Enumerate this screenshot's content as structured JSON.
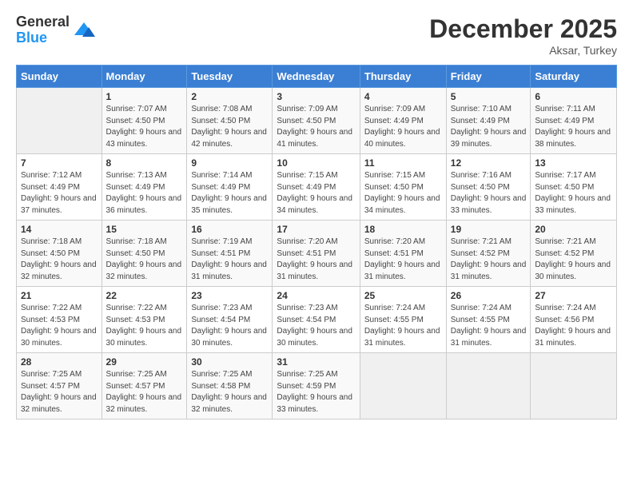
{
  "logo": {
    "general": "General",
    "blue": "Blue"
  },
  "title": "December 2025",
  "location": "Aksar, Turkey",
  "days_header": [
    "Sunday",
    "Monday",
    "Tuesday",
    "Wednesday",
    "Thursday",
    "Friday",
    "Saturday"
  ],
  "weeks": [
    [
      {
        "day": "",
        "sunrise": "",
        "sunset": "",
        "daylight": ""
      },
      {
        "day": "1",
        "sunrise": "Sunrise: 7:07 AM",
        "sunset": "Sunset: 4:50 PM",
        "daylight": "Daylight: 9 hours and 43 minutes."
      },
      {
        "day": "2",
        "sunrise": "Sunrise: 7:08 AM",
        "sunset": "Sunset: 4:50 PM",
        "daylight": "Daylight: 9 hours and 42 minutes."
      },
      {
        "day": "3",
        "sunrise": "Sunrise: 7:09 AM",
        "sunset": "Sunset: 4:50 PM",
        "daylight": "Daylight: 9 hours and 41 minutes."
      },
      {
        "day": "4",
        "sunrise": "Sunrise: 7:09 AM",
        "sunset": "Sunset: 4:49 PM",
        "daylight": "Daylight: 9 hours and 40 minutes."
      },
      {
        "day": "5",
        "sunrise": "Sunrise: 7:10 AM",
        "sunset": "Sunset: 4:49 PM",
        "daylight": "Daylight: 9 hours and 39 minutes."
      },
      {
        "day": "6",
        "sunrise": "Sunrise: 7:11 AM",
        "sunset": "Sunset: 4:49 PM",
        "daylight": "Daylight: 9 hours and 38 minutes."
      }
    ],
    [
      {
        "day": "7",
        "sunrise": "Sunrise: 7:12 AM",
        "sunset": "Sunset: 4:49 PM",
        "daylight": "Daylight: 9 hours and 37 minutes."
      },
      {
        "day": "8",
        "sunrise": "Sunrise: 7:13 AM",
        "sunset": "Sunset: 4:49 PM",
        "daylight": "Daylight: 9 hours and 36 minutes."
      },
      {
        "day": "9",
        "sunrise": "Sunrise: 7:14 AM",
        "sunset": "Sunset: 4:49 PM",
        "daylight": "Daylight: 9 hours and 35 minutes."
      },
      {
        "day": "10",
        "sunrise": "Sunrise: 7:15 AM",
        "sunset": "Sunset: 4:49 PM",
        "daylight": "Daylight: 9 hours and 34 minutes."
      },
      {
        "day": "11",
        "sunrise": "Sunrise: 7:15 AM",
        "sunset": "Sunset: 4:50 PM",
        "daylight": "Daylight: 9 hours and 34 minutes."
      },
      {
        "day": "12",
        "sunrise": "Sunrise: 7:16 AM",
        "sunset": "Sunset: 4:50 PM",
        "daylight": "Daylight: 9 hours and 33 minutes."
      },
      {
        "day": "13",
        "sunrise": "Sunrise: 7:17 AM",
        "sunset": "Sunset: 4:50 PM",
        "daylight": "Daylight: 9 hours and 33 minutes."
      }
    ],
    [
      {
        "day": "14",
        "sunrise": "Sunrise: 7:18 AM",
        "sunset": "Sunset: 4:50 PM",
        "daylight": "Daylight: 9 hours and 32 minutes."
      },
      {
        "day": "15",
        "sunrise": "Sunrise: 7:18 AM",
        "sunset": "Sunset: 4:50 PM",
        "daylight": "Daylight: 9 hours and 32 minutes."
      },
      {
        "day": "16",
        "sunrise": "Sunrise: 7:19 AM",
        "sunset": "Sunset: 4:51 PM",
        "daylight": "Daylight: 9 hours and 31 minutes."
      },
      {
        "day": "17",
        "sunrise": "Sunrise: 7:20 AM",
        "sunset": "Sunset: 4:51 PM",
        "daylight": "Daylight: 9 hours and 31 minutes."
      },
      {
        "day": "18",
        "sunrise": "Sunrise: 7:20 AM",
        "sunset": "Sunset: 4:51 PM",
        "daylight": "Daylight: 9 hours and 31 minutes."
      },
      {
        "day": "19",
        "sunrise": "Sunrise: 7:21 AM",
        "sunset": "Sunset: 4:52 PM",
        "daylight": "Daylight: 9 hours and 31 minutes."
      },
      {
        "day": "20",
        "sunrise": "Sunrise: 7:21 AM",
        "sunset": "Sunset: 4:52 PM",
        "daylight": "Daylight: 9 hours and 30 minutes."
      }
    ],
    [
      {
        "day": "21",
        "sunrise": "Sunrise: 7:22 AM",
        "sunset": "Sunset: 4:53 PM",
        "daylight": "Daylight: 9 hours and 30 minutes."
      },
      {
        "day": "22",
        "sunrise": "Sunrise: 7:22 AM",
        "sunset": "Sunset: 4:53 PM",
        "daylight": "Daylight: 9 hours and 30 minutes."
      },
      {
        "day": "23",
        "sunrise": "Sunrise: 7:23 AM",
        "sunset": "Sunset: 4:54 PM",
        "daylight": "Daylight: 9 hours and 30 minutes."
      },
      {
        "day": "24",
        "sunrise": "Sunrise: 7:23 AM",
        "sunset": "Sunset: 4:54 PM",
        "daylight": "Daylight: 9 hours and 30 minutes."
      },
      {
        "day": "25",
        "sunrise": "Sunrise: 7:24 AM",
        "sunset": "Sunset: 4:55 PM",
        "daylight": "Daylight: 9 hours and 31 minutes."
      },
      {
        "day": "26",
        "sunrise": "Sunrise: 7:24 AM",
        "sunset": "Sunset: 4:55 PM",
        "daylight": "Daylight: 9 hours and 31 minutes."
      },
      {
        "day": "27",
        "sunrise": "Sunrise: 7:24 AM",
        "sunset": "Sunset: 4:56 PM",
        "daylight": "Daylight: 9 hours and 31 minutes."
      }
    ],
    [
      {
        "day": "28",
        "sunrise": "Sunrise: 7:25 AM",
        "sunset": "Sunset: 4:57 PM",
        "daylight": "Daylight: 9 hours and 32 minutes."
      },
      {
        "day": "29",
        "sunrise": "Sunrise: 7:25 AM",
        "sunset": "Sunset: 4:57 PM",
        "daylight": "Daylight: 9 hours and 32 minutes."
      },
      {
        "day": "30",
        "sunrise": "Sunrise: 7:25 AM",
        "sunset": "Sunset: 4:58 PM",
        "daylight": "Daylight: 9 hours and 32 minutes."
      },
      {
        "day": "31",
        "sunrise": "Sunrise: 7:25 AM",
        "sunset": "Sunset: 4:59 PM",
        "daylight": "Daylight: 9 hours and 33 minutes."
      },
      {
        "day": "",
        "sunrise": "",
        "sunset": "",
        "daylight": ""
      },
      {
        "day": "",
        "sunrise": "",
        "sunset": "",
        "daylight": ""
      },
      {
        "day": "",
        "sunrise": "",
        "sunset": "",
        "daylight": ""
      }
    ]
  ]
}
